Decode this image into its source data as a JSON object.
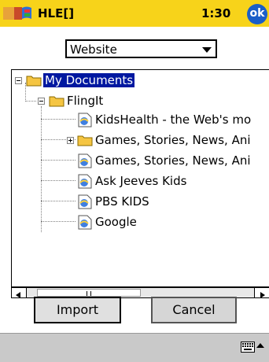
{
  "titlebar": {
    "app_name": "HLE[]",
    "time": "1:30",
    "ok_label": "ok"
  },
  "dropdown": {
    "selected": "Website"
  },
  "tree": {
    "root": "My Documents",
    "folder": "FlingIt",
    "items": [
      "KidsHealth - the Web's mo",
      "Games, Stories, News, Ani",
      "Games, Stories, News, Ani",
      "Ask Jeeves Kids",
      "PBS KIDS",
      "Google"
    ]
  },
  "buttons": {
    "import": "Import",
    "cancel": "Cancel"
  },
  "colors": {
    "titlebar": "#f7d31a",
    "selection": "#0018a0",
    "ok_button": "#1a5ec8"
  }
}
